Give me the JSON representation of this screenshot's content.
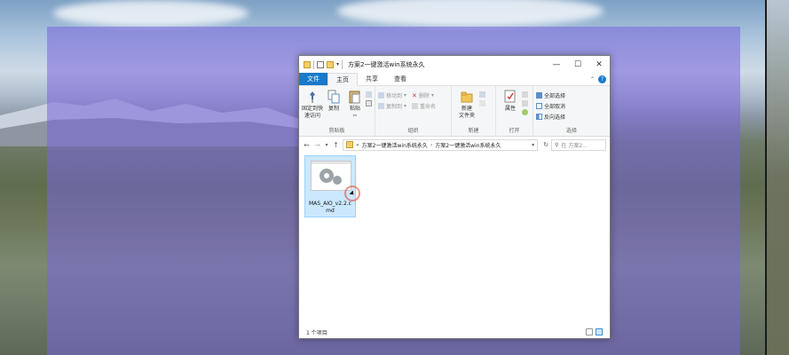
{
  "window": {
    "title": "方案2一键激活win系统永久",
    "minimize": "—",
    "maximize": "☐",
    "close": "✕"
  },
  "tabs": {
    "file": "文件",
    "home": "主页",
    "share": "共享",
    "view": "查看",
    "help": "?"
  },
  "ribbon": {
    "clipboard": {
      "label": "剪贴板",
      "pin": "固定到快\n速访问",
      "copy": "复制",
      "paste": "粘贴",
      "cut": "✂"
    },
    "organize": {
      "label": "组织",
      "move_to": "移动到",
      "copy_to": "复制到",
      "delete": "删除",
      "rename": "重命名"
    },
    "new": {
      "label": "新建",
      "new_folder": "新建\n文件夹"
    },
    "open": {
      "label": "打开",
      "properties": "属性"
    },
    "select": {
      "label": "选择",
      "select_all": "全部选择",
      "select_none": "全部取消",
      "invert": "反向选择"
    }
  },
  "address": {
    "crumbs": [
      "方案2一键激活win系统永久",
      "方案2一键激活win系统永久"
    ],
    "search_placeholder": "在 方案2..."
  },
  "files": [
    {
      "name": "MAS_AIO_v2.2.c\nmd",
      "selected": true
    }
  ],
  "status": {
    "count": "1 个项目"
  }
}
